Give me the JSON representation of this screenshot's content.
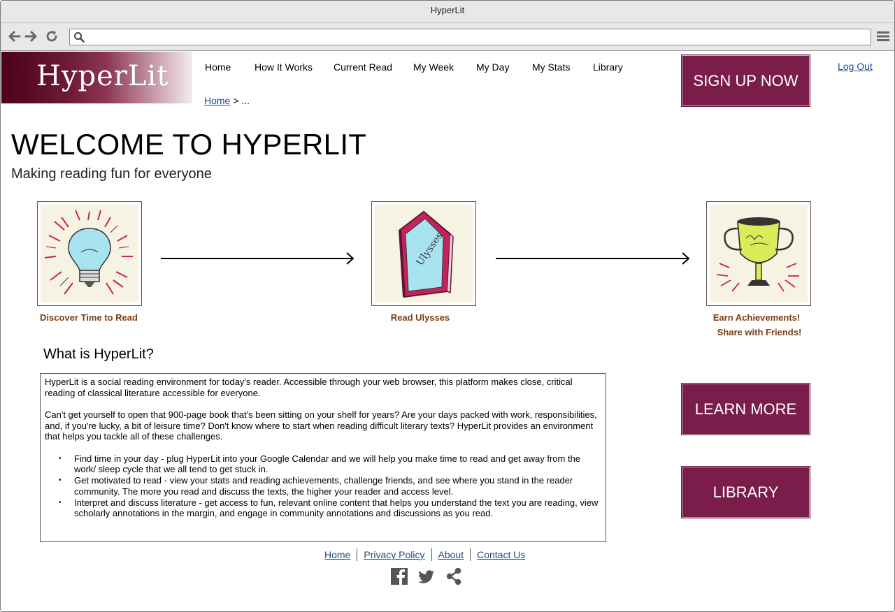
{
  "window": {
    "title": "HyperLit"
  },
  "browser": {
    "url_value": "",
    "url_placeholder": ""
  },
  "brand": {
    "logo_text": "HyperLit",
    "accent": "#7a1d4a",
    "label_color": "#7a3e12",
    "link_color": "#1a4a8c"
  },
  "nav": {
    "items": [
      {
        "label": "Home"
      },
      {
        "label": "How It Works"
      },
      {
        "label": "Current Read"
      },
      {
        "label": "My Week"
      },
      {
        "label": "My Day"
      },
      {
        "label": "My Stats"
      },
      {
        "label": "Library"
      }
    ],
    "logout": "Log Out",
    "signup": "SIGN UP NOW"
  },
  "breadcrumb": {
    "home": "Home",
    "separator": ">",
    "current": "..."
  },
  "hero": {
    "title": "WELCOME TO HYPERLIT",
    "subtitle": "Making reading fun for everyone"
  },
  "steps": [
    {
      "label": "Discover Time to Read",
      "icon": "lightbulb-icon"
    },
    {
      "label": "Read Ulysses",
      "icon": "book-icon",
      "book_title": "Ulysses"
    },
    {
      "label_line1": "Earn Achievements!",
      "label_line2": "Share with Friends!",
      "icon": "trophy-icon"
    }
  ],
  "about": {
    "title": "What is HyperLit?",
    "paragraphs": [
      "HyperLit is a social reading environment for today's reader. Accessible through your web browser, this platform makes close, critical reading of classical literature accessible for everyone.",
      "Can't get yourself to open that 900-page book that's been sitting on your shelf for years? Are your days packed with work, responsibilities, and, if you're lucky, a bit of leisure time? Don't know where to start when reading difficult literary texts? HyperLit provides an environment that helps you tackle all of these challenges."
    ],
    "bullets": [
      "Find time in your day - plug HyperLit into your Google Calendar and we will help you make time to read and get away from the work/ sleep cycle that we all tend to get stuck in.",
      "Get motivated to read - view your stats and reading achievements, challenge friends, and see where you stand in the reader community. The more you read and discuss the texts, the higher your reader and access level.",
      "Interpret and discuss literature - get access to fun, relevant online content that helps you understand the text you are reading, view scholarly annotations in the margin, and engage in community annotations and discussions as you read."
    ]
  },
  "sidebar": {
    "learn_more": "LEARN MORE",
    "library": "LIBRARY"
  },
  "footer": {
    "links": [
      "Home",
      "Privacy Policy",
      "About",
      "Contact Us"
    ],
    "social": [
      "facebook-icon",
      "twitter-icon",
      "share-icon"
    ]
  }
}
